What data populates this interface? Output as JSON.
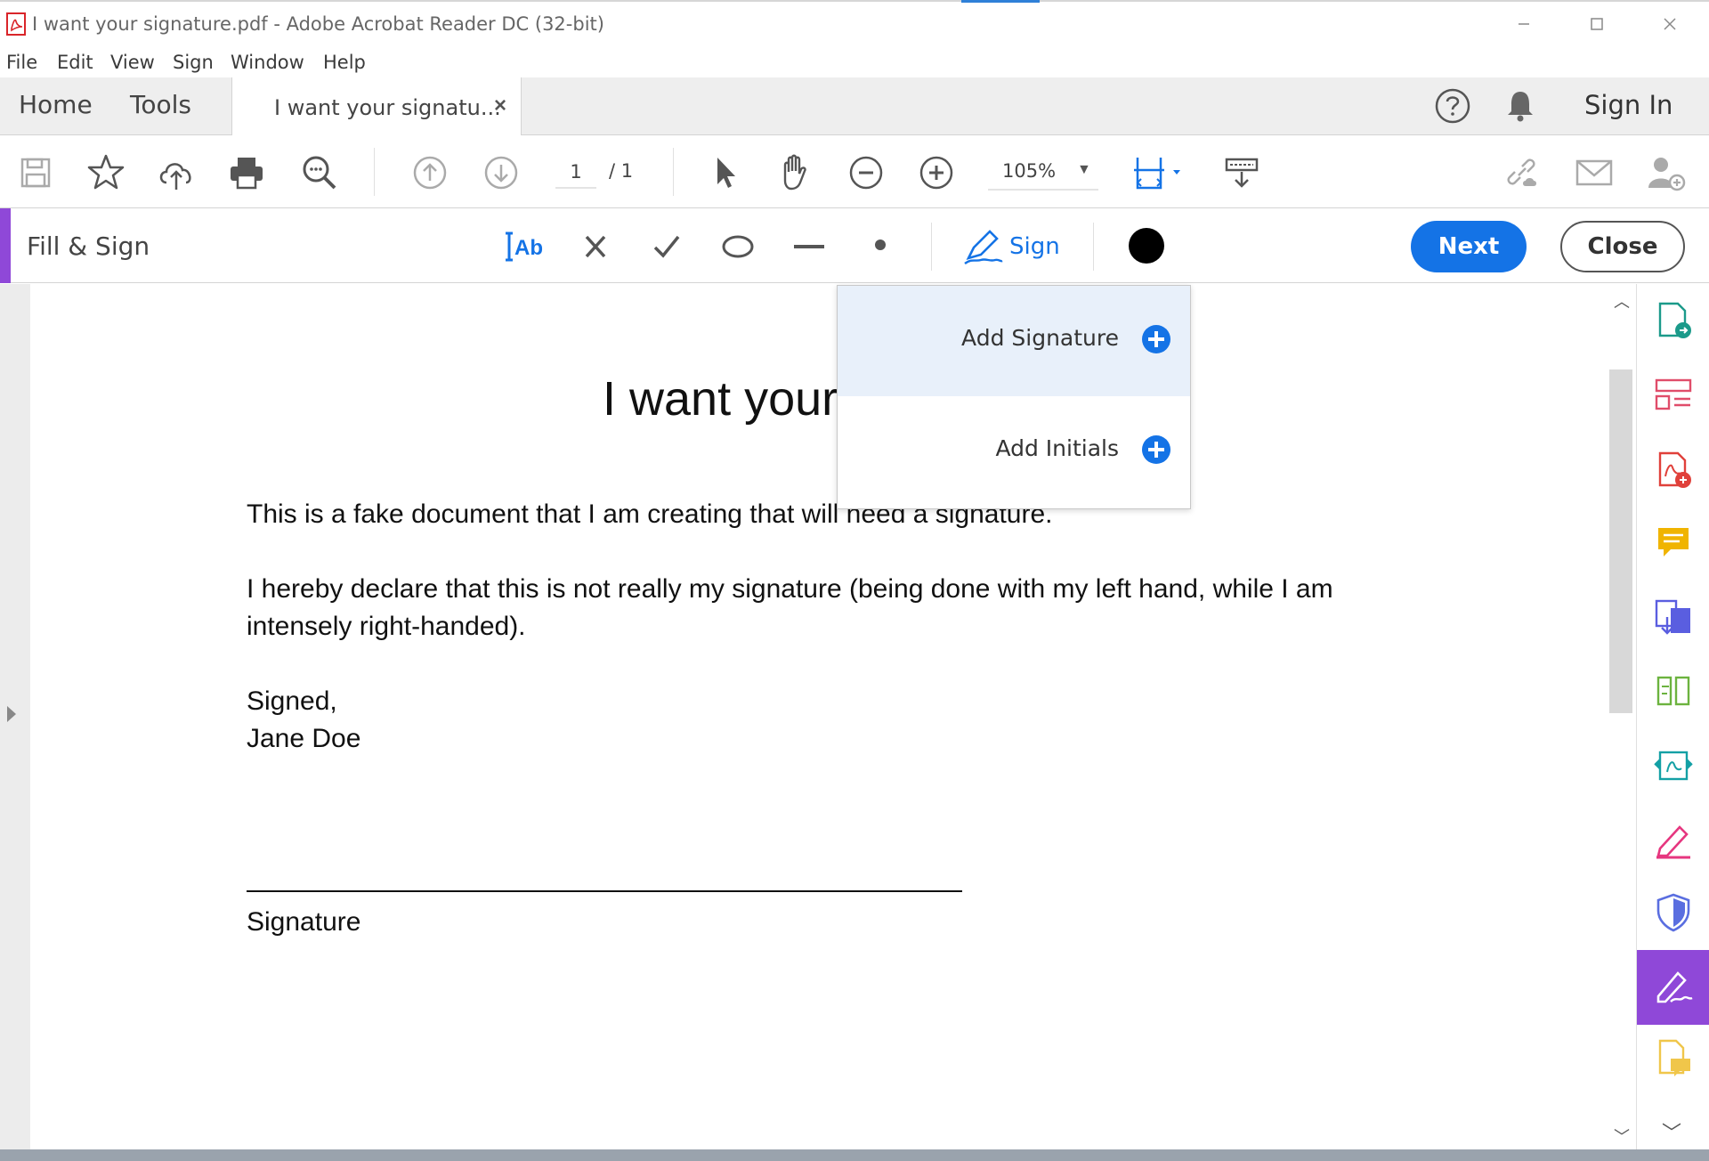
{
  "window": {
    "title": "I want your signature.pdf - Adobe Acrobat Reader DC (32-bit)",
    "controls": [
      "minimize",
      "maximize",
      "close"
    ]
  },
  "menu": {
    "file": "File",
    "edit": "Edit",
    "view": "View",
    "sign": "Sign",
    "window": "Window",
    "help": "Help"
  },
  "tabs": {
    "home": "Home",
    "tools": "Tools",
    "document": "I want your signatu...",
    "close_glyph": "×",
    "sign_in": "Sign In"
  },
  "toolbar": {
    "page_current": "1",
    "page_total": "/ 1",
    "zoom": "105%"
  },
  "fill_sign": {
    "title": "Fill & Sign",
    "sign_label": "Sign",
    "next_label": "Next",
    "close_label": "Close",
    "current_color": "#000000"
  },
  "sign_menu": {
    "add_signature": "Add Signature",
    "add_initials": "Add Initials"
  },
  "document": {
    "heading": "I want your",
    "para1": "This is a fake document that I am creating that will need a signature.",
    "para2": "I hereby declare that this is not really my signature (being done with my left hand, while I am intensely right-handed).",
    "signed": "Signed,",
    "name": "Jane Doe",
    "signature_label": "Signature"
  },
  "colors": {
    "accent_blue": "#1473e6",
    "fill_sign_purple": "#8f48d8"
  }
}
